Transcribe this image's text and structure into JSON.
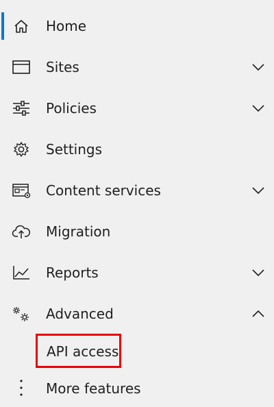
{
  "nav": {
    "items": [
      {
        "label": "Home",
        "icon": "home-icon",
        "active": true
      },
      {
        "label": "Sites",
        "icon": "sites-icon",
        "chevron": "down"
      },
      {
        "label": "Policies",
        "icon": "policies-icon",
        "chevron": "down"
      },
      {
        "label": "Settings",
        "icon": "gear-icon"
      },
      {
        "label": "Content services",
        "icon": "content-services-icon",
        "chevron": "down"
      },
      {
        "label": "Migration",
        "icon": "cloud-upload-icon"
      },
      {
        "label": "Reports",
        "icon": "line-chart-icon",
        "chevron": "down"
      },
      {
        "label": "Advanced",
        "icon": "gears-icon",
        "chevron": "up",
        "expanded": true
      }
    ],
    "advanced_sub": {
      "label": "API access"
    },
    "more": {
      "label": "More features",
      "icon": "more-vertical-icon"
    }
  },
  "colors": {
    "background": "#f0f0f0",
    "active_indicator": "#0078d4",
    "highlight_box": "#e8000b",
    "text": "#1f1f1f"
  }
}
